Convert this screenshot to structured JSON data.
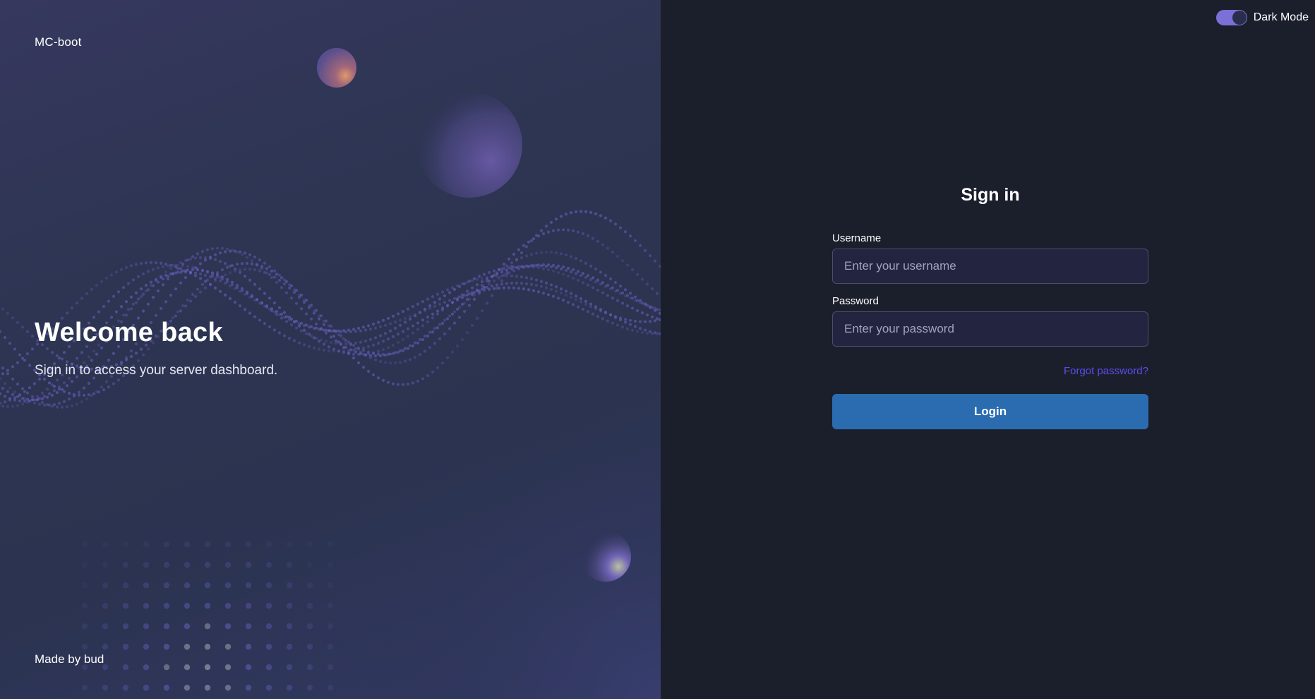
{
  "brand": {
    "name": "MC-boot"
  },
  "hero": {
    "title": "Welcome back",
    "subtitle": "Sign in to access your server dashboard.",
    "footer": "Made by bud"
  },
  "theme_toggle": {
    "label": "Dark Mode",
    "checked": true,
    "accent_color": "#7b70d6"
  },
  "login_form": {
    "title": "Sign in",
    "username": {
      "label": "Username",
      "placeholder": "Enter your username",
      "value": ""
    },
    "password": {
      "label": "Password",
      "placeholder": "Enter your password",
      "value": ""
    },
    "forgot_password": "Forgot password?",
    "submit_label": "Login"
  },
  "colors": {
    "panel_background": "#1b1f2c",
    "input_background": "#232540",
    "primary_button": "#2b6cb0",
    "link": "#5b4dea"
  },
  "icons": {
    "toggle": "switch-icon"
  }
}
